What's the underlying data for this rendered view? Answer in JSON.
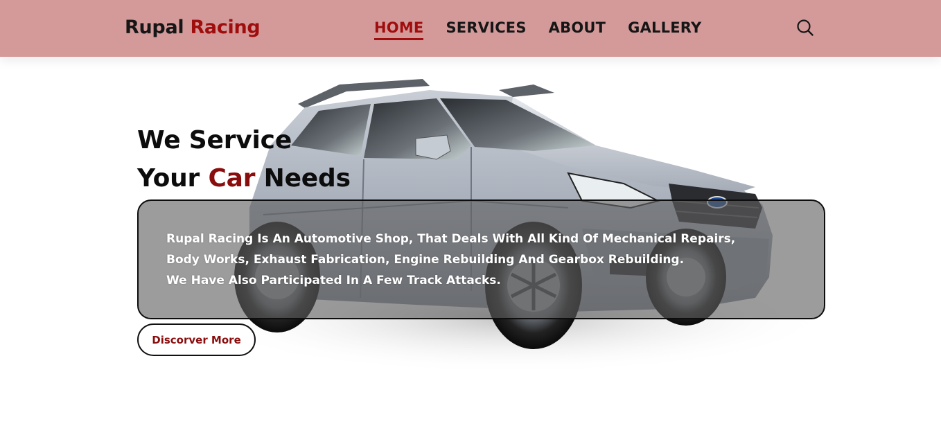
{
  "brand": {
    "name_part1": "Rupal",
    "name_part2": "Racing"
  },
  "nav": {
    "items": [
      {
        "label": "HOME",
        "active": true
      },
      {
        "label": "SERVICES",
        "active": false
      },
      {
        "label": "ABOUT",
        "active": false
      },
      {
        "label": "GALLERY",
        "active": false
      }
    ]
  },
  "header": {
    "search_icon": "search-icon"
  },
  "hero": {
    "headline_line1": "We Service",
    "headline_line2_part1": "Your",
    "headline_line2_accent": "Car",
    "headline_line2_part2": "Needs",
    "description_lines": [
      "Rupal Racing Is An Automotive Shop, That Deals With All Kind Of Mechanical Repairs,",
      "Body Works, Exhaust Fabrication, Engine Rebuilding And Gearbox Rebuilding.",
      "We Have Also Participated In A Few Track Attacks."
    ],
    "cta_label": "Discorver More"
  },
  "colors": {
    "header_bg": "#d49a9a",
    "accent": "#a00d0d",
    "text": "#161616",
    "overlay": "#5f5f5f"
  }
}
